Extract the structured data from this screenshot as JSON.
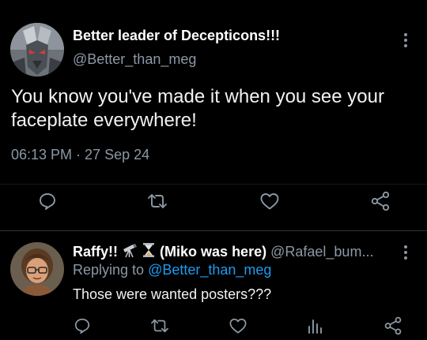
{
  "tweet": {
    "display_name": "Better leader of Decepticons!!!",
    "handle": "@Better_than_meg",
    "text": "You know you've made it when you see your faceplate everywhere!",
    "timestamp": "06:13 PM · 27 Sep 24",
    "actions": [
      "reply-icon",
      "retweet-icon",
      "like-icon",
      "share-icon"
    ]
  },
  "reply": {
    "display_name_pre": "Raffy!!",
    "emoji": [
      "telescope-icon",
      "hourglass-icon"
    ],
    "display_name_post": "(Miko was here)",
    "handle": "@Rafael_bum...",
    "replying_prefix": "Replying to",
    "replying_to": "@Better_than_meg",
    "text": "Those were wanted posters???",
    "actions": [
      "reply-icon",
      "retweet-icon",
      "like-icon",
      "views-icon",
      "share-icon"
    ]
  },
  "colors": {
    "background": "#000000",
    "text_primary": "#e7e9ea",
    "text_secondary": "#8b98a5",
    "link": "#1d9bf0",
    "divider": "#2f3336"
  }
}
